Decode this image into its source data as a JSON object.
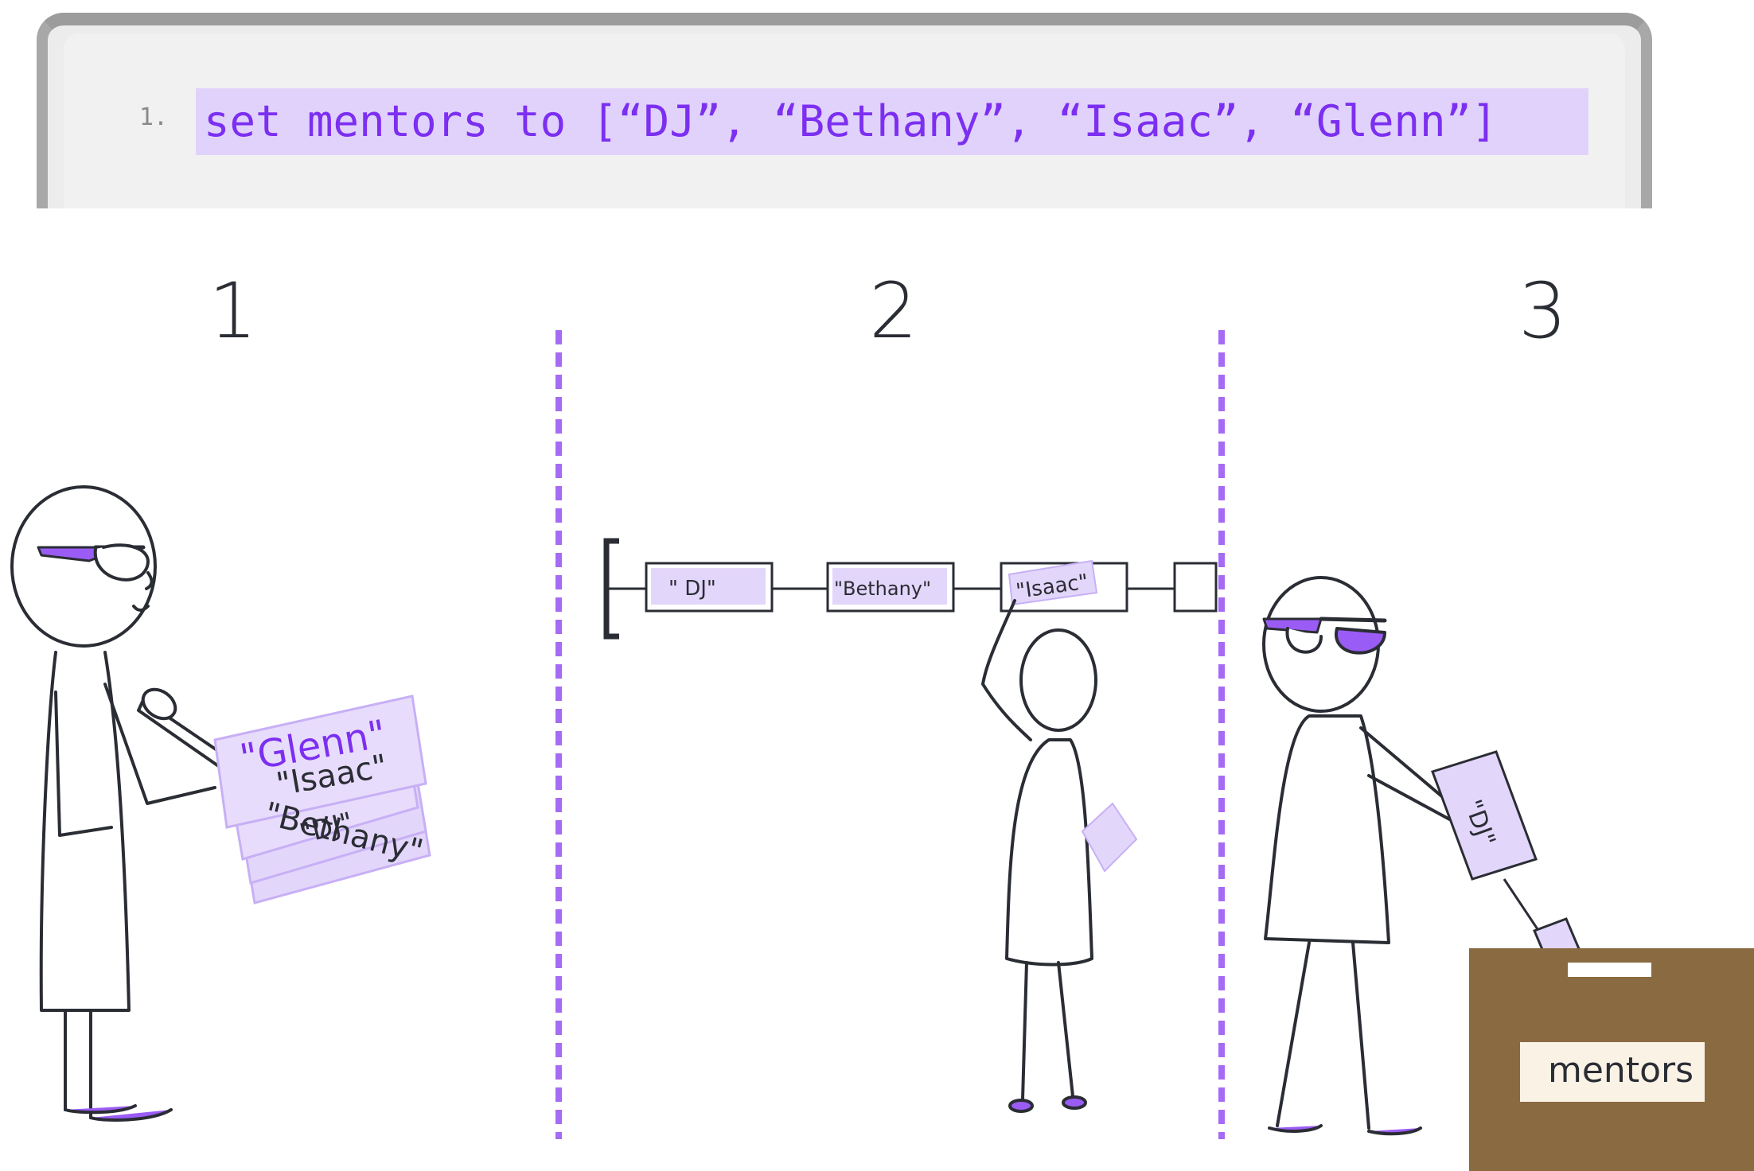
{
  "code": {
    "line_number": "1.",
    "statement": "set mentors to [“DJ”, “Bethany”, “Isaac”, “Glenn”]"
  },
  "steps": [
    "1",
    "2",
    "3"
  ],
  "scene1": {
    "cards": [
      "\"Glenn\"",
      "\"Isaac\"",
      "\"Bethany\"",
      "\"DJ\""
    ]
  },
  "scene2": {
    "list_items": [
      "\" DJ\"",
      "\"Bethany\"",
      "\"Isaac\""
    ]
  },
  "scene3": {
    "card": "\"DJ\"",
    "box_label": "mentors"
  },
  "colors": {
    "accent": "#9b5cf6",
    "highlight": "#e0d2fb",
    "code_text": "#7c2ff0",
    "ink": "#2a2d34",
    "box": "#8a6a41"
  }
}
